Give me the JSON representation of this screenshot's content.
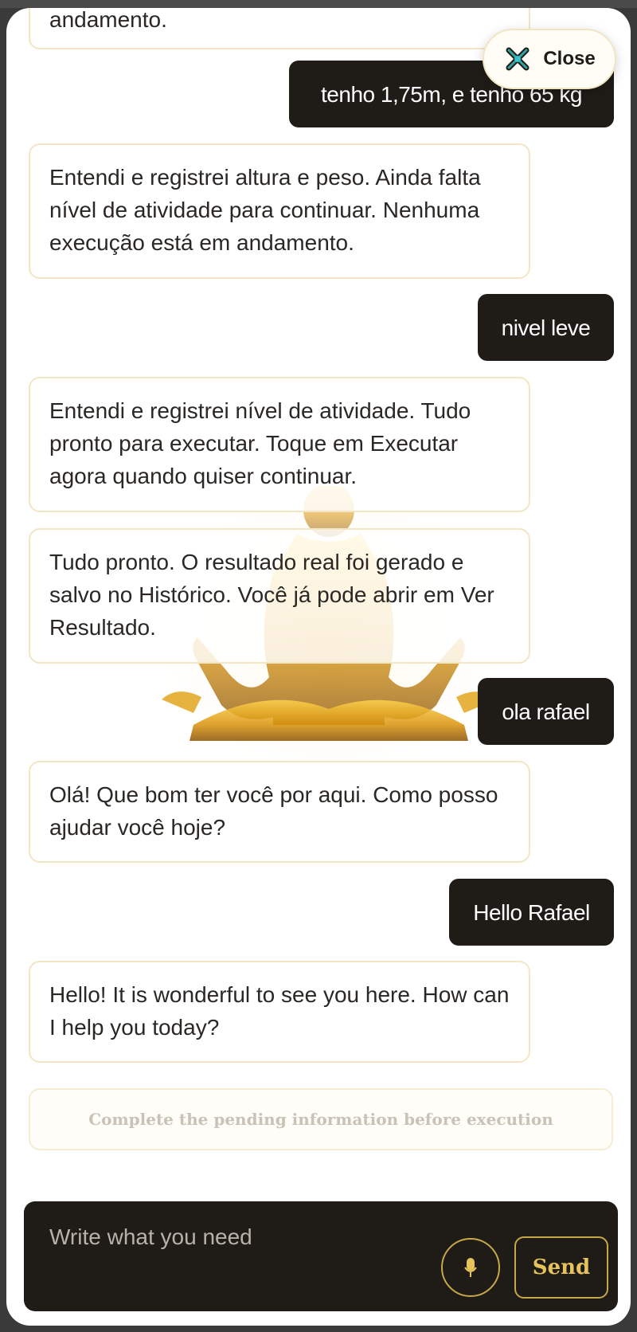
{
  "window": {
    "close_label": "Close"
  },
  "messages": [
    {
      "role": "bot",
      "text": "andamento."
    },
    {
      "role": "user",
      "text": "tenho 1,75m, e tenho 65 kg"
    },
    {
      "role": "bot",
      "text": "Entendi e registrei altura e peso. Ainda falta nível de atividade para continuar. Nenhuma execução está em andamento."
    },
    {
      "role": "user",
      "text": "nivel leve"
    },
    {
      "role": "bot",
      "text": "Entendi e registrei nível de atividade. Tudo pronto para executar. Toque em Executar agora quando quiser continuar."
    },
    {
      "role": "bot",
      "text": "Tudo pronto. O resultado real foi gerado e salvo no Histórico. Você já pode abrir em Ver Resultado."
    },
    {
      "role": "user",
      "text": "ola rafael"
    },
    {
      "role": "bot",
      "text": "Olá! Que bom ter você por aqui. Como posso ajudar você hoje?"
    },
    {
      "role": "user",
      "text": "Hello Rafael"
    },
    {
      "role": "bot",
      "text": "Hello! It is wonderful to see you here. How can I help you today?"
    }
  ],
  "status": {
    "pending_text": "Complete the pending information before execution"
  },
  "composer": {
    "placeholder": "Write what you need",
    "value": "",
    "send_label": "Send",
    "mic_icon": "microphone-icon"
  },
  "icons": {
    "close": "close-x-icon",
    "background": "meditation-figure"
  },
  "colors": {
    "accent_gold": "#c8a74a",
    "dark": "#1f1b17",
    "bubble_border": "#f2e6c4",
    "pending_text": "#c9c2b6"
  }
}
